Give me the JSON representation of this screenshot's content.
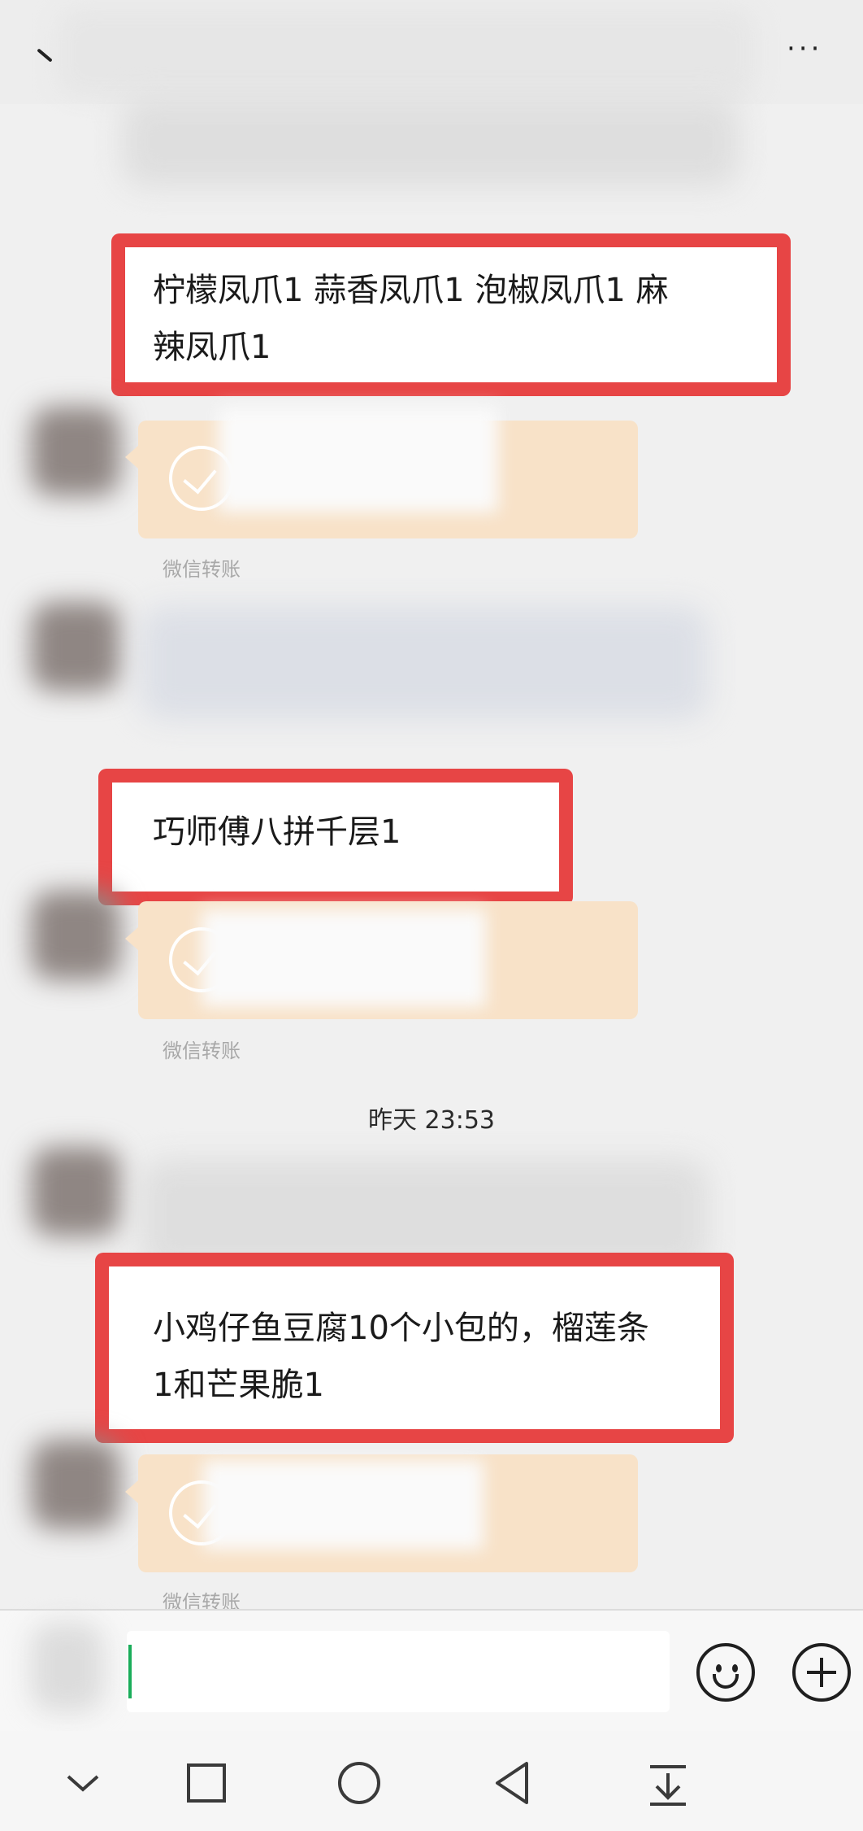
{
  "messages": [
    {
      "text_line1": "柠檬凤爪1 蒜香凤爪1 泡椒凤爪1 麻",
      "text_line2": "辣凤爪1"
    },
    {
      "text_line1": "巧师傅八拼千层1"
    },
    {
      "text_line1": "小鸡仔鱼豆腐10个小包的，榴莲条",
      "text_line2": "1和芒果脆1"
    }
  ],
  "transfers": [
    {
      "label": "微信转账"
    },
    {
      "label": "微信转账"
    },
    {
      "label": "微信转账"
    }
  ],
  "timestamp": "昨天 23:53",
  "header": {
    "more_label": "···"
  },
  "colors": {
    "highlight": "#e74545",
    "transfer_bg": "#f8e2c8",
    "cursor": "#1aad5a"
  },
  "icons": {
    "back": "back-arrow-icon",
    "more": "more-dots-icon",
    "emoji": "emoji-icon",
    "plus": "plus-icon",
    "nav": [
      "chevron-down-icon",
      "square-icon",
      "circle-icon",
      "triangle-back-icon",
      "download-icon"
    ]
  }
}
